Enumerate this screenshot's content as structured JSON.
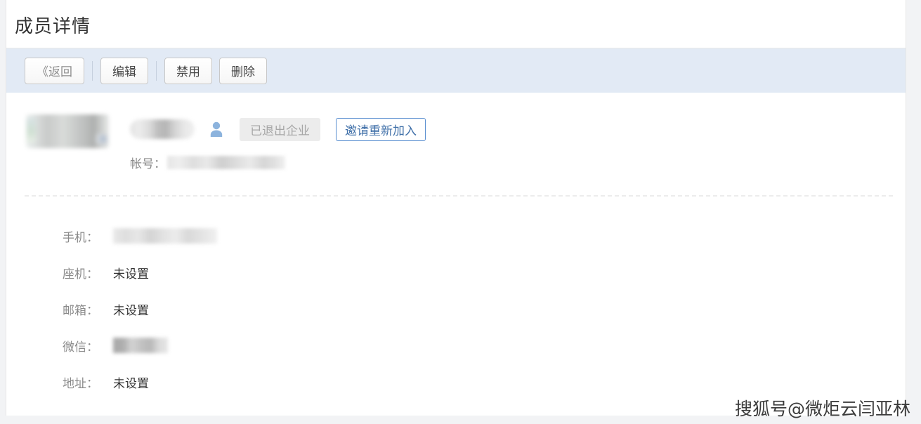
{
  "page": {
    "title": "成员详情"
  },
  "toolbar": {
    "back_label": "《返回",
    "edit_label": "编辑",
    "disable_label": "禁用",
    "delete_label": "删除"
  },
  "profile": {
    "avatar_icon": "user-avatar-image",
    "name_redacted": "",
    "user_icon": "user-silhouette-icon",
    "status_badge": "已退出企业",
    "invite_button": "邀请重新加入",
    "account_label": "帐号：",
    "account_value_redacted": ""
  },
  "details": {
    "rows": [
      {
        "label": "手机：",
        "value": "",
        "redacted": true
      },
      {
        "label": "座机：",
        "value": "未设置",
        "redacted": false
      },
      {
        "label": "邮箱：",
        "value": "未设置",
        "redacted": false
      },
      {
        "label": "微信：",
        "value": "",
        "redacted": true
      },
      {
        "label": "地址：",
        "value": "未设置",
        "redacted": false
      }
    ]
  },
  "watermark": {
    "text": "搜狐号@微炬云闫亚林"
  },
  "colors": {
    "toolbar_bg": "#e2eaf5",
    "page_bg": "#f2f3f5",
    "content_bg": "#ffffff",
    "label_gray": "#8a8a8a",
    "value_dark": "#333333",
    "badge_bg": "#ececec",
    "badge_text": "#a6a6a6",
    "invite_border": "#5a8fd0",
    "invite_text": "#3f6fa8",
    "user_icon_blue": "#8cb3dd"
  }
}
